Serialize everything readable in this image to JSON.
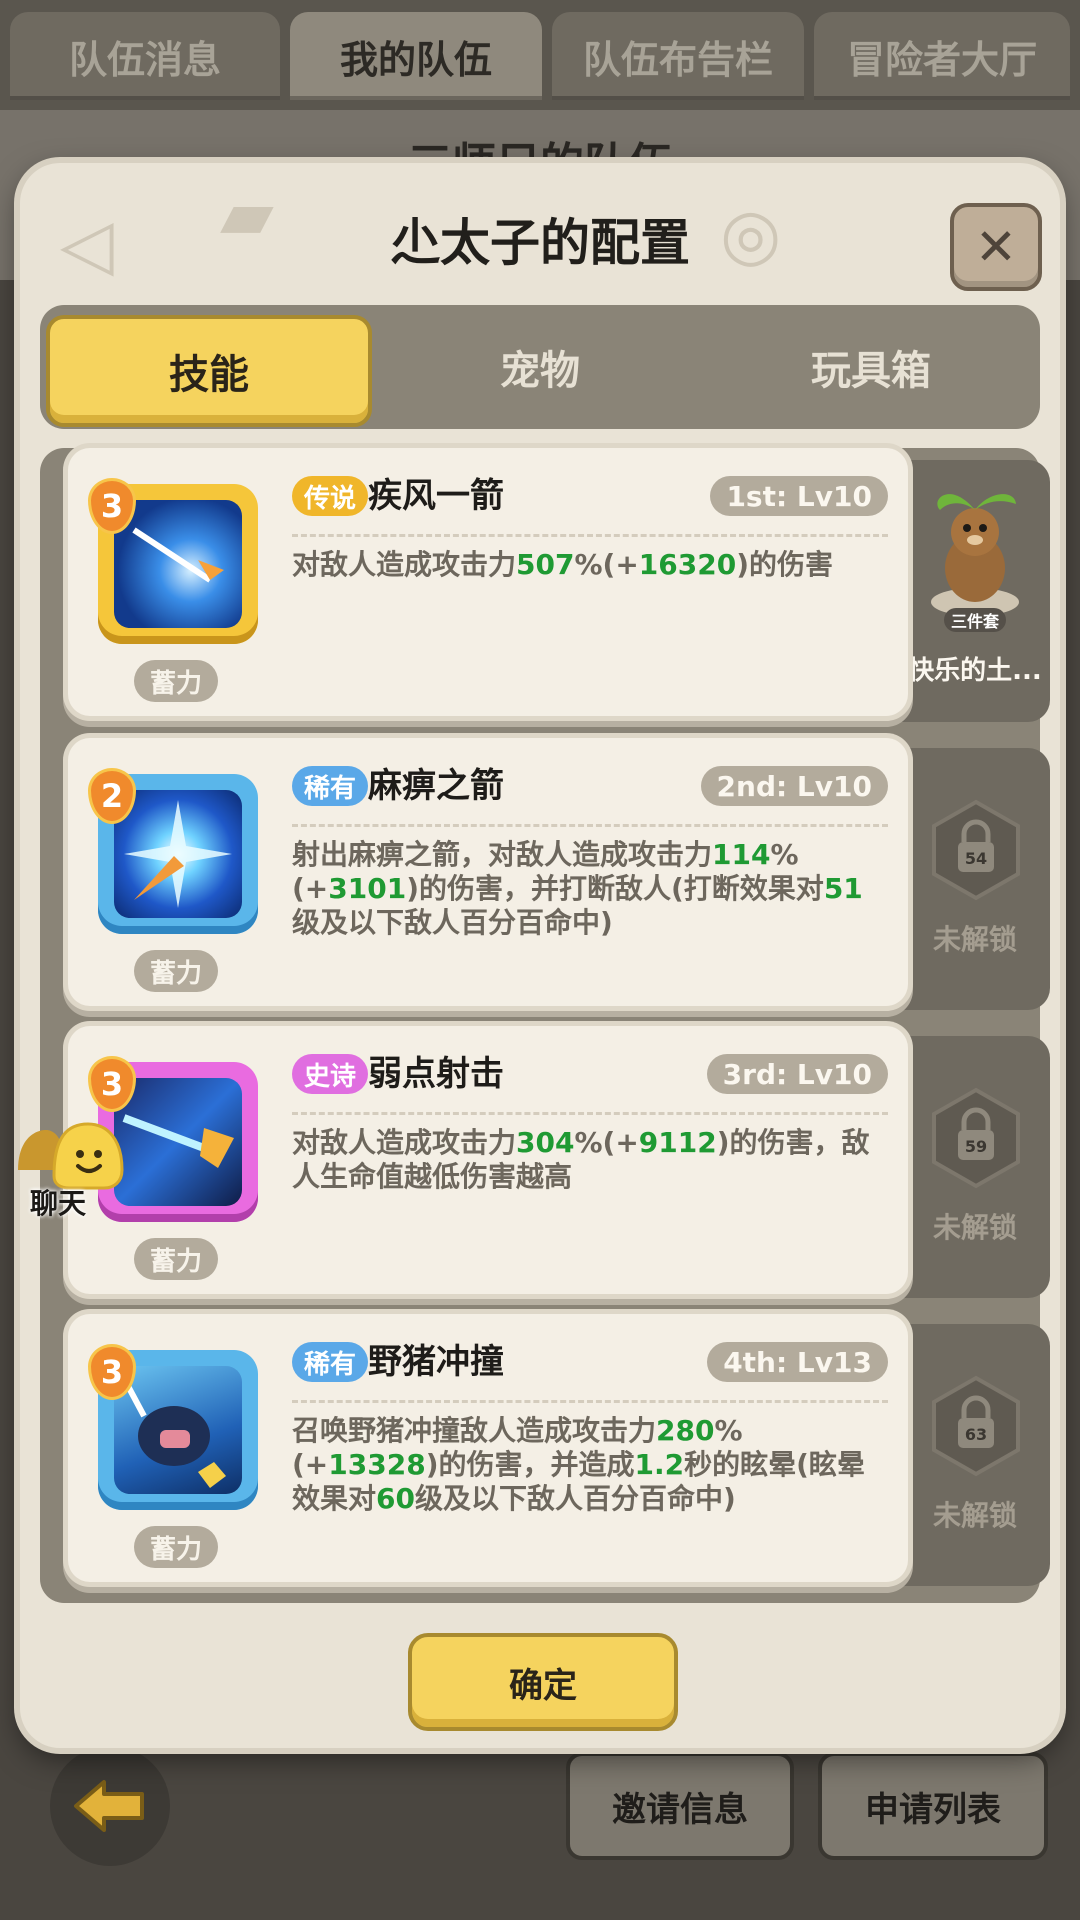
{
  "top_tabs": [
    {
      "label": "队伍消息",
      "active": false
    },
    {
      "label": "我的队伍",
      "active": true
    },
    {
      "label": "队伍布告栏",
      "active": false
    },
    {
      "label": "冒险者大厅",
      "active": false
    }
  ],
  "background_title": "三师兄的队伍",
  "modal": {
    "title": "尐太子的配置",
    "close_icon": "close-icon",
    "segments": [
      {
        "label": "技能",
        "active": true
      },
      {
        "label": "宠物",
        "active": false
      },
      {
        "label": "玩具箱",
        "active": false
      }
    ],
    "skills": [
      {
        "level_badge": "3",
        "rarity": "传说",
        "rarity_color": "#f0b62a",
        "name": "疾风一箭",
        "slot": "1st: Lv10",
        "tag": "蓄力",
        "desc_parts": [
          "对敌人造成攻击力",
          "507",
          "%(+",
          "16320",
          ")的伤害"
        ],
        "frame_color": "#f5c63a"
      },
      {
        "level_badge": "2",
        "rarity": "稀有",
        "rarity_color": "#5aa8e8",
        "name": "麻痹之箭",
        "slot": "2nd: Lv10",
        "tag": "蓄力",
        "desc_parts": [
          "射出麻痹之箭，对敌人造成攻击力",
          "114",
          "%(+",
          "3101",
          ")的伤害，并打断敌人(打断效果对",
          "51",
          "级及以下敌人百分百命中)"
        ],
        "frame_color": "#5ab6ea"
      },
      {
        "level_badge": "3",
        "rarity": "史诗",
        "rarity_color": "#e06ee0",
        "name": "弱点射击",
        "slot": "3rd: Lv10",
        "tag": "蓄力",
        "desc_parts": [
          "对敌人造成攻击力",
          "304",
          "%(+",
          "9112",
          ")的伤害，敌人生命值越低伤害越高"
        ],
        "frame_color": "#e96be0"
      },
      {
        "level_badge": "3",
        "rarity": "稀有",
        "rarity_color": "#5aa8e8",
        "name": "野猪冲撞",
        "slot": "4th: Lv13",
        "tag": "蓄力",
        "desc_parts": [
          "召唤野猪冲撞敌人造成攻击力",
          "280",
          "%(+",
          "13328",
          ")的伤害，并造成",
          "1.2",
          "秒的眩晕(眩晕效果对",
          "60",
          "级及以下敌人百分百命中)"
        ],
        "frame_color": "#5ab6ea"
      }
    ],
    "side_slots": [
      {
        "type": "pet",
        "name": "快乐的土...",
        "badge": "三件套"
      },
      {
        "type": "locked",
        "level": "54",
        "label": "未解锁"
      },
      {
        "type": "locked",
        "level": "59",
        "label": "未解锁"
      },
      {
        "type": "locked",
        "level": "63",
        "label": "未解锁"
      }
    ],
    "confirm_label": "确定"
  },
  "chat": {
    "label": "聊天"
  },
  "bottom": {
    "invite_label": "邀请信息",
    "apply_label": "申请列表"
  }
}
